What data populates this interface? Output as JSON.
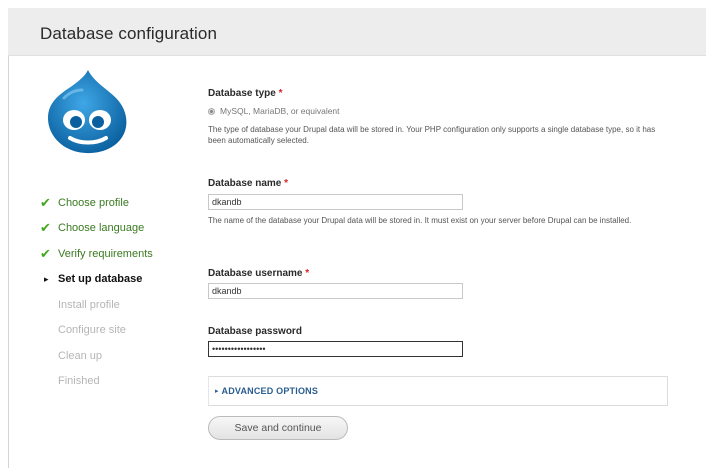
{
  "page": {
    "title": "Database configuration"
  },
  "sidebar": {
    "steps": [
      {
        "label": "Choose profile",
        "state": "done"
      },
      {
        "label": "Choose language",
        "state": "done"
      },
      {
        "label": "Verify requirements",
        "state": "done"
      },
      {
        "label": "Set up database",
        "state": "current"
      },
      {
        "label": "Install profile",
        "state": "pending"
      },
      {
        "label": "Configure site",
        "state": "pending"
      },
      {
        "label": "Clean up",
        "state": "pending"
      },
      {
        "label": "Finished",
        "state": "pending"
      }
    ],
    "icons": {
      "done": "✔",
      "current": "▸"
    }
  },
  "form": {
    "db_type": {
      "label": "Database type",
      "required_mark": "*",
      "option": "MySQL, MariaDB, or equivalent",
      "description": "The type of database your Drupal data will be stored in. Your PHP configuration only supports a single database type, so it has been automatically selected."
    },
    "db_name": {
      "label": "Database name",
      "required_mark": "*",
      "value": "dkandb",
      "description": "The name of the database your Drupal data will be stored in. It must exist on your server before Drupal can be installed."
    },
    "db_user": {
      "label": "Database username",
      "required_mark": "*",
      "value": "dkandb"
    },
    "db_pass": {
      "label": "Database password",
      "value": "•••••••••••••••••"
    },
    "advanced": {
      "label": "ADVANCED OPTIONS",
      "icon": "▸"
    },
    "submit": {
      "label": "Save and continue"
    }
  },
  "colors": {
    "header_bg": "#ededed",
    "done_green": "#44a61e",
    "required_red": "#dd2222",
    "link_blue": "#2a5d8f",
    "logo_blue": "#0678be"
  }
}
